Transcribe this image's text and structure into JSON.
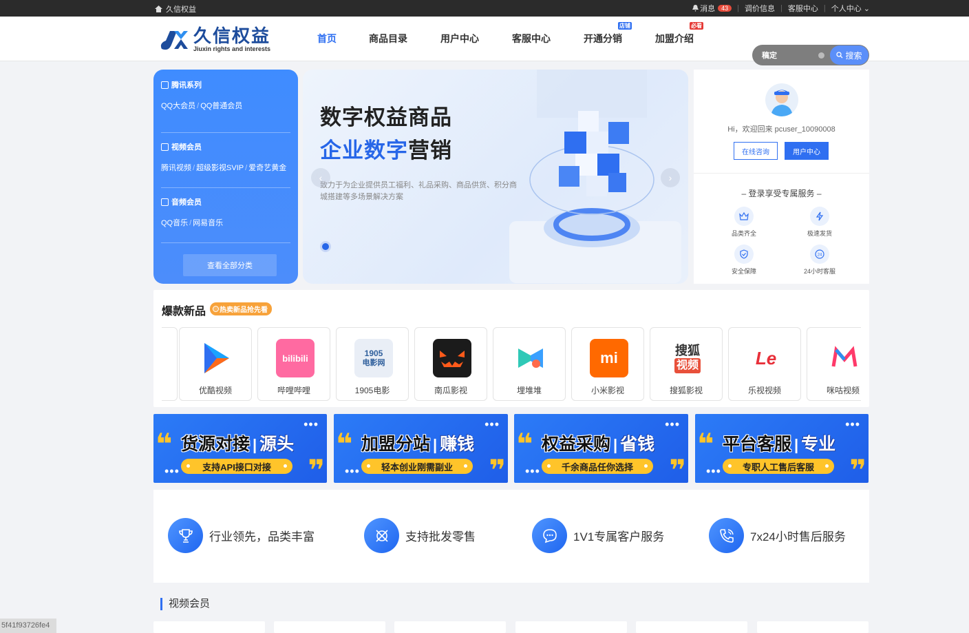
{
  "topbar": {
    "site_name": "久信权益",
    "messages_label": "消息",
    "messages_count": "43",
    "recharge_label": "调价信息",
    "service_label": "客服中心",
    "personal_label": "个人中心"
  },
  "header": {
    "logo_cn": "久信权益",
    "logo_en": "Jiuxin rights and interests",
    "nav": [
      {
        "label": "首页",
        "tag": ""
      },
      {
        "label": "商品目录",
        "tag": ""
      },
      {
        "label": "用户中心",
        "tag": ""
      },
      {
        "label": "客服中心",
        "tag": ""
      },
      {
        "label": "开通分销",
        "tag": "店铺"
      },
      {
        "label": "加盟介绍",
        "tag": "必看"
      }
    ],
    "search_value": "稿定",
    "search_button": "搜索"
  },
  "categories": [
    {
      "title": "腾讯系列",
      "links": [
        "QQ大会员",
        "QQ普通会员"
      ]
    },
    {
      "title": "视频会员",
      "links": [
        "腾讯视频",
        "超级影视SVIP",
        "爱奇艺黄金"
      ]
    },
    {
      "title": "音频会员",
      "links": [
        "QQ音乐",
        "网易音乐"
      ]
    }
  ],
  "categories_all": "查看全部分类",
  "banner": {
    "line1": "数字权益商品",
    "line2_blue": "企业数字",
    "line2_rest": "营销",
    "desc": "致力于为企业提供员工福利、礼品采购、商品供货、积分商城搭建等多场景解决方案"
  },
  "user": {
    "welcome": "Hi，欢迎回来 pcuser_10090008",
    "btn_consult": "在线咨询",
    "btn_center": "用户中心",
    "login_title": "– 登录享受专属服务 –",
    "services": [
      "品类齐全",
      "极速发货",
      "安全保障",
      "24小时客服"
    ]
  },
  "hot": {
    "title": "爆款新品",
    "tag": "热卖新品抢先看",
    "products": [
      "优酷视频",
      "哔哩哔哩",
      "1905电影",
      "南瓜影视",
      "埋堆堆",
      "小米影视",
      "搜狐影视",
      "乐视视频",
      "咪咕视频"
    ]
  },
  "promos": [
    {
      "title": "货源对接",
      "highlight": "源头",
      "sub": "支持API接口对接"
    },
    {
      "title": "加盟分站",
      "highlight": "赚钱",
      "sub": "轻本创业刚需副业"
    },
    {
      "title": "权益采购",
      "highlight": "省钱",
      "sub": "千余商品任你选择"
    },
    {
      "title": "平台客服",
      "highlight": "专业",
      "sub": "专职人工售后客服"
    }
  ],
  "features": [
    "行业领先，品类丰富",
    "支持批发零售",
    "1V1专属客户服务",
    "7x24小时售后服务"
  ],
  "section_title": "视频会员",
  "watermark": "5f41f93726fe4",
  "colors": {
    "accent": "#2f6ff1",
    "topbar": "#2b2b2b",
    "promo_yellow": "#ffc42a"
  }
}
